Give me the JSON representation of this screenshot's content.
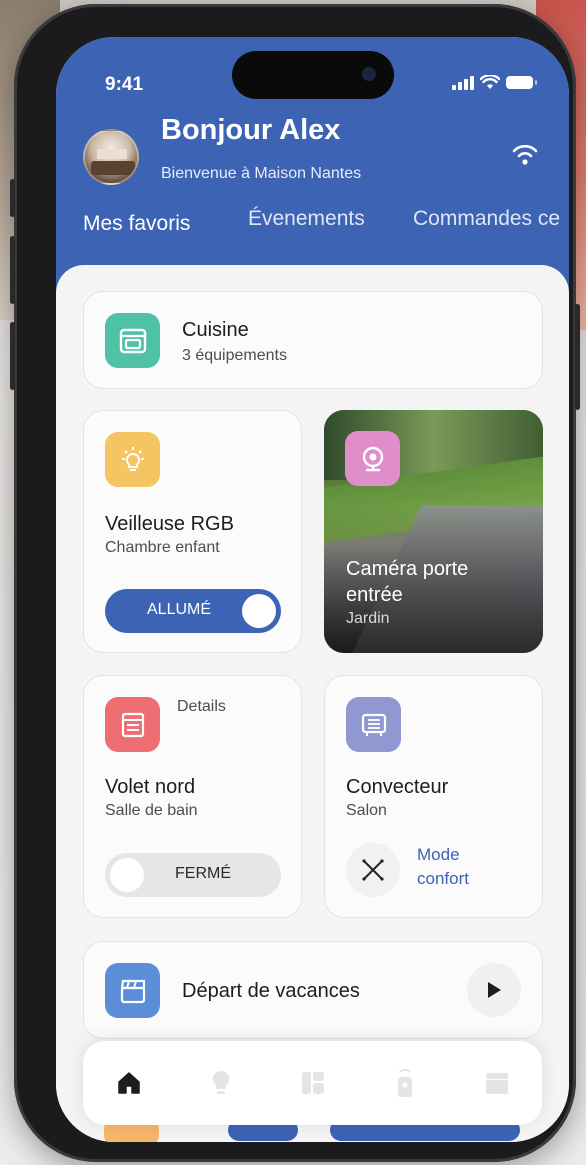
{
  "status_bar": {
    "time": "9:41"
  },
  "header": {
    "greeting": "Bonjour Alex",
    "subtitle": "Bienvenue à Maison Nantes",
    "tabs": [
      {
        "label": "Mes favoris",
        "active": true
      },
      {
        "label": "Évenements",
        "active": false
      },
      {
        "label": "Commandes ce",
        "active": false
      }
    ]
  },
  "room_card": {
    "title": "Cuisine",
    "subtitle": "3 équipements",
    "icon": "oven-icon",
    "color": "#4fc2a6"
  },
  "devices": [
    {
      "title": "Veilleuse RGB",
      "subtitle": "Chambre enfant",
      "icon": "lightbulb-icon",
      "color": "#f5c563",
      "toggle_label": "ALLUMÉ",
      "state": "on"
    },
    {
      "title": "Caméra porte entrée",
      "subtitle": "Jardin",
      "icon": "camera-icon",
      "color": "#e08ec9"
    },
    {
      "title": "Volet nord",
      "subtitle": "Salle de bain",
      "icon": "shutter-icon",
      "color": "#ee6e73",
      "toggle_label": "FERMÉ",
      "state": "off",
      "details_label": "Details"
    },
    {
      "title": "Convecteur",
      "subtitle": "Salon",
      "icon": "heater-icon",
      "color": "#8f98d1",
      "mode_label": "Mode confort"
    }
  ],
  "scenario": {
    "title": "Départ de vacances",
    "icon": "clapperboard-icon",
    "color": "#5b8ed6"
  },
  "navbar": {
    "items": [
      "home-icon",
      "lightbulb-icon",
      "dashboard-icon",
      "remote-icon",
      "clapperboard-icon"
    ],
    "active": "home-icon"
  },
  "colors": {
    "primary": "#3d63b4",
    "toggle_on": "#3d63b4",
    "toggle_off": "#e6e6e6"
  }
}
